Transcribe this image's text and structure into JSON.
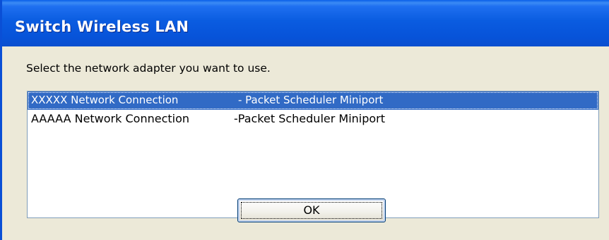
{
  "window": {
    "title": "Switch Wireless LAN"
  },
  "dialog": {
    "prompt": "Select the network adapter you want to use.",
    "adapters": [
      {
        "name": "XXXXX Network Connection",
        "driver": "- Packet Scheduler Miniport",
        "selected": true
      },
      {
        "name": "AAAAA Network Connection",
        "driver": "-Packet Scheduler Miniport",
        "selected": false
      }
    ],
    "ok_label": "OK"
  },
  "colors": {
    "titlebar": "#0a5ce0",
    "selection": "#316ac5",
    "dialog_background": "#ece9d8"
  }
}
